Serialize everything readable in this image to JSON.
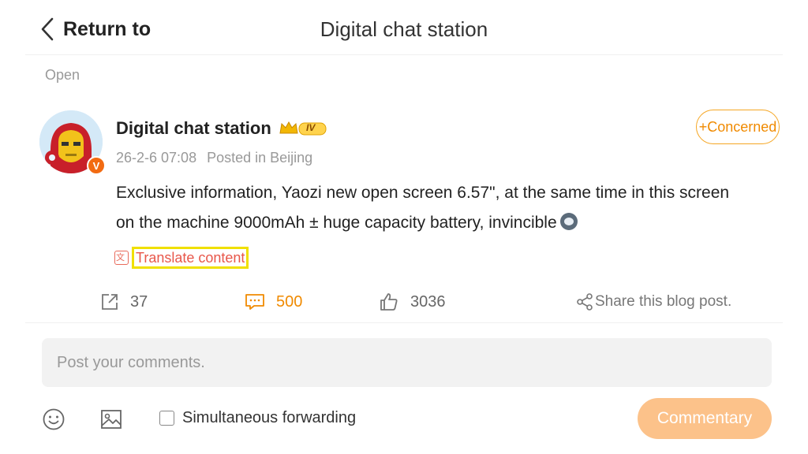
{
  "header": {
    "back_label": "Return to",
    "title": "Digital chat station"
  },
  "section_label": "Open",
  "post": {
    "author": "Digital chat station",
    "vip_level": "IV",
    "verified_badge": "V",
    "timestamp": "26-2-6 07:08",
    "location": "Posted in Beijing",
    "follow_label": "+Concerned",
    "content": "Exclusive information, Yaozi new open screen 6.57\", at the same time in this screen on the machine 9000mAh ± huge capacity battery, invincible",
    "translate_label": "Translate content"
  },
  "actions": {
    "repost_count": "37",
    "comment_count": "500",
    "like_count": "3036",
    "share_label": "Share this blog post."
  },
  "composer": {
    "placeholder": "Post your comments.",
    "forward_label": "Simultaneous forwarding",
    "submit_label": "Commentary"
  },
  "colors": {
    "accent": "#f08a00",
    "translate": "#e8574a",
    "submit_bg": "#fcc28a",
    "highlight": "#f0e000"
  }
}
